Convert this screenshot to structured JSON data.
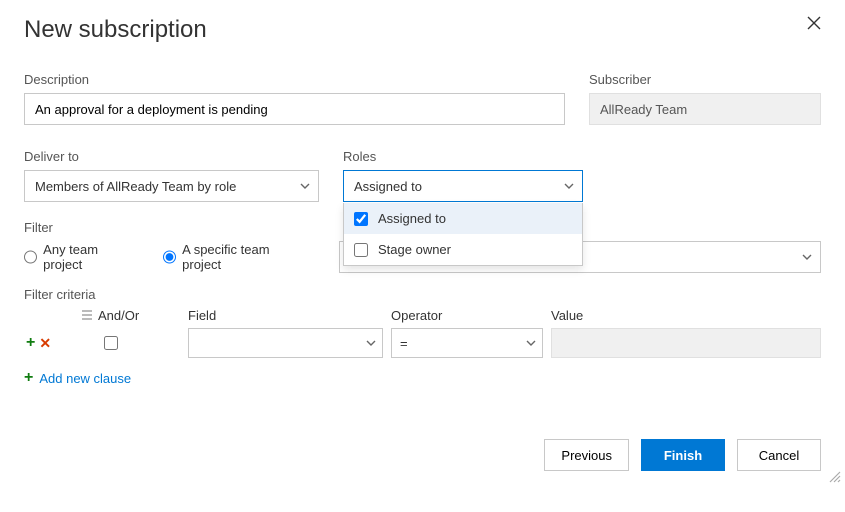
{
  "dialog": {
    "title": "New subscription"
  },
  "fields": {
    "description": {
      "label": "Description",
      "value": "An approval for a deployment is pending"
    },
    "subscriber": {
      "label": "Subscriber",
      "value": "AllReady Team"
    },
    "deliverTo": {
      "label": "Deliver to",
      "value": "Members of AllReady Team by role"
    },
    "roles": {
      "label": "Roles",
      "value": "Assigned to",
      "options": [
        {
          "label": "Assigned to",
          "checked": true
        },
        {
          "label": "Stage owner",
          "checked": false
        }
      ]
    }
  },
  "filter": {
    "label": "Filter",
    "options": {
      "any": "Any team project",
      "specific": "A specific team project"
    },
    "selected": "specific"
  },
  "criteria": {
    "label": "Filter criteria",
    "headers": {
      "andOr": "And/Or",
      "field": "Field",
      "operator": "Operator",
      "value": "Value"
    },
    "row": {
      "operator": "="
    },
    "addClause": "Add new clause"
  },
  "footer": {
    "previous": "Previous",
    "finish": "Finish",
    "cancel": "Cancel"
  }
}
